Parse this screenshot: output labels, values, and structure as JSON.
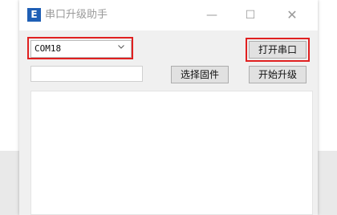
{
  "window": {
    "icon_letter": "E",
    "title": "串口升级助手",
    "minimize_glyph": "—",
    "maximize_glyph": "☐",
    "close_glyph": "✕"
  },
  "serial": {
    "port_value": "COM18",
    "open_button_label": "打开串口"
  },
  "firmware": {
    "path_value": "",
    "select_button_label": "选择固件",
    "upgrade_button_label": "开始升级"
  },
  "log": {
    "content": ""
  },
  "colors": {
    "highlight_box": "#e02020",
    "icon_bg": "#1f5fb5"
  }
}
